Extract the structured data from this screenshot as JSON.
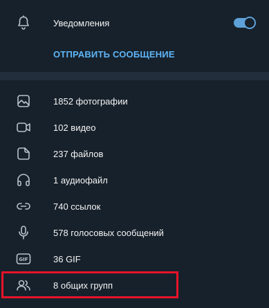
{
  "notifications": {
    "label": "Уведомления",
    "enabled": true,
    "icon": "bell-icon"
  },
  "send_message": {
    "label": "ОТПРАВИТЬ СООБЩЕНИЕ"
  },
  "media": [
    {
      "key": "photos",
      "label": "1852 фотографии",
      "icon": "photo-icon"
    },
    {
      "key": "videos",
      "label": "102 видео",
      "icon": "video-icon"
    },
    {
      "key": "files",
      "label": "237 файлов",
      "icon": "file-icon"
    },
    {
      "key": "audio",
      "label": "1 аудиофайл",
      "icon": "headphones-icon"
    },
    {
      "key": "links",
      "label": "740 ссылок",
      "icon": "link-icon"
    },
    {
      "key": "voice",
      "label": "578 голосовых сообщений",
      "icon": "microphone-icon"
    },
    {
      "key": "gif",
      "label": "36 GIF",
      "icon": "gif-icon"
    },
    {
      "key": "groups",
      "label": "8 общих групп",
      "icon": "users-icon"
    }
  ],
  "colors": {
    "background": "#17212b",
    "divider": "#232e3c",
    "accent": "#5eb5f7",
    "toggle": "#5ea1d8",
    "icon": "#b9c3cd",
    "highlight": "#e8132a"
  }
}
